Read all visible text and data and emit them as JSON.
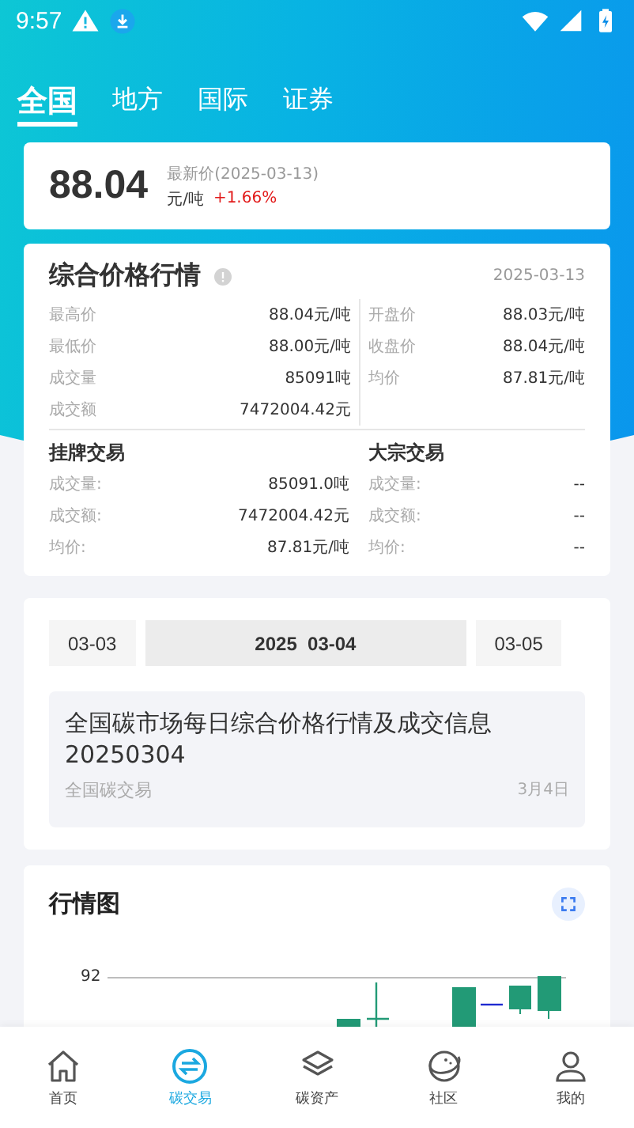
{
  "status_bar": {
    "time": "9:57"
  },
  "tabs": [
    {
      "label": "全国",
      "selected": true
    },
    {
      "label": "地方",
      "selected": false
    },
    {
      "label": "国际",
      "selected": false
    },
    {
      "label": "证券",
      "selected": false
    }
  ],
  "price_card": {
    "price": "88.04",
    "label": "最新价(2025-03-13)",
    "unit": "元/吨",
    "change": "+1.66%"
  },
  "summary": {
    "title": "综合价格行情",
    "date": "2025-03-13",
    "left_rows": [
      {
        "label": "最高价",
        "value": "88.04元/吨"
      },
      {
        "label": "最低价",
        "value": "88.00元/吨"
      },
      {
        "label": "成交量",
        "value": "85091吨"
      },
      {
        "label": "成交额",
        "value": "7472004.42元"
      }
    ],
    "right_rows": [
      {
        "label": "开盘价",
        "value": "88.03元/吨"
      },
      {
        "label": "收盘价",
        "value": "88.04元/吨"
      },
      {
        "label": "均价",
        "value": "87.81元/吨"
      }
    ],
    "sections": [
      {
        "title": "挂牌交易",
        "rows": [
          {
            "label": "成交量:",
            "value": "85091.0吨"
          },
          {
            "label": "成交额:",
            "value": "7472004.42元"
          },
          {
            "label": "均价:",
            "value": "87.81元/吨"
          }
        ]
      },
      {
        "title": "大宗交易",
        "rows": [
          {
            "label": "成交量:",
            "value": "--"
          },
          {
            "label": "成交额:",
            "value": "--"
          },
          {
            "label": "均价:",
            "value": "--"
          }
        ]
      }
    ]
  },
  "dates": [
    {
      "label": "03-03",
      "selected": false
    },
    {
      "label": "2025  03-04",
      "selected": true
    },
    {
      "label": "03-05",
      "selected": false
    }
  ],
  "news": {
    "title": "全国碳市场每日综合价格行情及成交信息20250304",
    "source": "全国碳交易",
    "date": "3月4日"
  },
  "chart_card": {
    "title": "行情图",
    "y_tick": "92"
  },
  "nav": [
    {
      "label": "首页",
      "kind": "home",
      "selected": false
    },
    {
      "label": "碳交易",
      "kind": "exchange",
      "selected": true
    },
    {
      "label": "碳资产",
      "kind": "layers",
      "selected": false
    },
    {
      "label": "社区",
      "kind": "planet",
      "selected": false
    },
    {
      "label": "我的",
      "kind": "person",
      "selected": false
    }
  ]
}
